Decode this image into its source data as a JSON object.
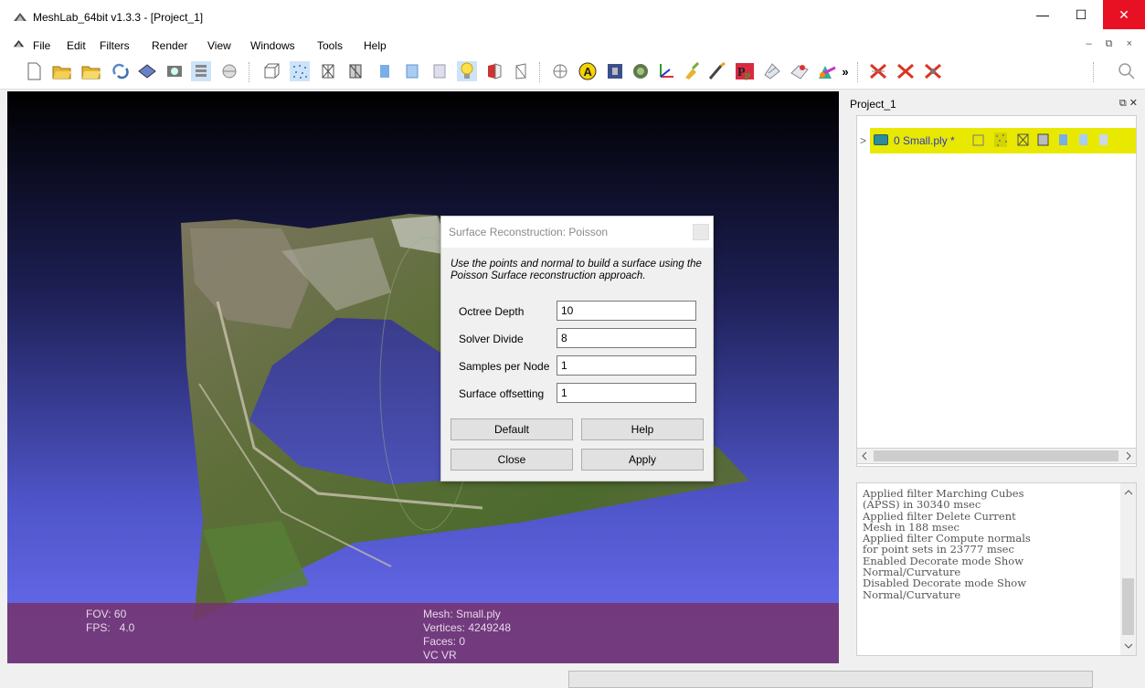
{
  "window": {
    "title": "MeshLab_64bit v1.3.3 - [Project_1]",
    "controls": {
      "minimize": "—",
      "maximize": "☐",
      "close": "✕"
    }
  },
  "menu": {
    "items": [
      "File",
      "Edit",
      "Filters",
      "Render",
      "View",
      "Windows",
      "Tools",
      "Help"
    ],
    "mdi_controls": "– ⧉ ×"
  },
  "toolbar": {
    "icons": [
      "new-document-icon",
      "open-folder-icon",
      "open-project-icon",
      "reload-icon",
      "save-icon",
      "snapshot-icon",
      "layers-icon",
      "sphere-icon",
      "bounding-box-icon",
      "points-icon",
      "wireframe-icon",
      "hidden-lines-icon",
      "flat-shading-icon",
      "smooth-shading-icon",
      "texture-icon",
      "light-icon",
      "double-side-icon",
      "color-icon",
      "trackball-icon",
      "info-icon",
      "ruler-icon",
      "radar-icon",
      "axis-icon",
      "paint-icon",
      "brush-icon",
      "plugin-icon",
      "select-faces-icon",
      "select-vertices-icon",
      "more-icon",
      "delete-faces-icon",
      "delete-vertices-icon",
      "delete-all-icon",
      "search-icon"
    ],
    "overflow_label": "»"
  },
  "viewport": {
    "info": {
      "fov": "FOV: 60",
      "fps": "FPS:   4.0",
      "mesh": "Mesh: Small.ply",
      "vertices": "Vertices: 4249248",
      "faces": "Faces: 0",
      "vcvr": "VC VR"
    }
  },
  "dialog": {
    "title": "Surface Reconstruction: Poisson",
    "description": "Use the points and normal to build a surface using the Poisson Surface reconstruction approach.",
    "params": [
      {
        "label": "Octree Depth",
        "value": "10"
      },
      {
        "label": "Solver Divide",
        "value": "8"
      },
      {
        "label": "Samples per Node",
        "value": "1"
      },
      {
        "label": "Surface offsetting",
        "value": "1"
      }
    ],
    "buttons": {
      "default": "Default",
      "help": "Help",
      "close": "Close",
      "apply": "Apply"
    }
  },
  "project": {
    "title": "Project_1",
    "controls": "⧉ ✕",
    "layer": {
      "name": "0 Small.ply *",
      "expander": ">"
    }
  },
  "log": {
    "text": "Applied filter Marching Cubes\n(APSS) in 30340 msec\nApplied filter Delete Current\nMesh in 188 msec\nApplied filter Compute normals\nfor point sets in 23777 msec\nEnabled Decorate mode Show\nNormal/Curvature\nDisabled Decorate mode Show\nNormal/Curvature"
  },
  "colors": {
    "close_button": "#e81123",
    "layer_highlight": "#e8e800",
    "info_bar": "#74346e",
    "viewport_bottom": "#6c6ff2"
  }
}
